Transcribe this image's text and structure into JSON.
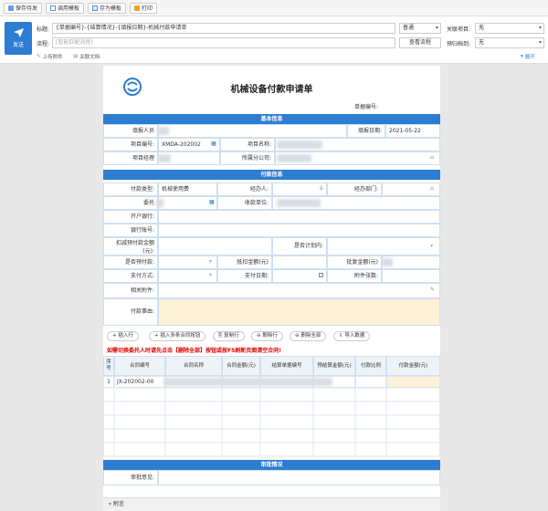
{
  "toolbar": {
    "buttons": [
      {
        "label": "保存待发",
        "icon": "save-icon"
      },
      {
        "label": "调用模板",
        "icon": "template-icon"
      },
      {
        "label": "存为模板",
        "icon": "save-as-template-icon"
      },
      {
        "label": "打印",
        "icon": "print-icon"
      }
    ]
  },
  "header": {
    "send_label": "发送",
    "title_label": "标题:",
    "title_value": "{单据编号}-{结算情况}-{填报日期}-机械付款申请单",
    "flow_label": "流程:",
    "flow_placeholder": "[智能匹配流程]",
    "level_value": "普通",
    "view_flow_label": "查看流程",
    "related_project_label": "关联项目:",
    "related_project_value": "无",
    "archive_label": "预归档到:",
    "archive_value": "无",
    "upload_label": "上传附件",
    "related_doc_label": "关联文档",
    "expand_label": "展开"
  },
  "form": {
    "title": "机械设备付款申请单",
    "doc_no_label": "单据编号:",
    "basic_section": "基本信息",
    "payment_section": "付款信息",
    "fields": {
      "reporter": "填报人员",
      "report_date": "填报日期:",
      "report_date_value": "2021-05-22",
      "project_no": "项目编号:",
      "project_no_value": "XMDA-202002",
      "project_name": "项目名称:",
      "project_manager": "项目经理",
      "branch": "所属分公司:",
      "pay_type": "付款类型:",
      "pay_type_value": "机械使用费",
      "handler": "经办人:",
      "handler_dept": "经办部门:",
      "entrust": "委托",
      "payee": "收款单位:",
      "bank": "开户银行:",
      "account": "银行账号:",
      "plan_amount": "扣减预付款金额",
      "plan_amount_unit": "(元):",
      "in_plan": "是否计划内:",
      "prepay": "是否预付款:",
      "deduct": "抵扣金额(元)",
      "approved": "批复金额(元)",
      "pay_method": "支付方式:",
      "pay_date": "支付日期:",
      "attach_count": "附件张数:",
      "attachments": "相关附件:",
      "reason": "付款事由:"
    },
    "actions": [
      "插入行",
      "插入多条合同按钮",
      "复制行",
      "删除行",
      "删除全部",
      "导入数据"
    ],
    "warning": "如需切换委托人时请先点击【删除全部】按钮或按F5刷新页面清空合同!",
    "table_headers": [
      "序号",
      "合同编号",
      "合同名称",
      "合同金额(元)",
      "结算单据编号",
      "预结算金额(元)",
      "付款比例",
      "付款金额(元)"
    ],
    "rows": [
      {
        "no": "1",
        "contract_no": "JX-202002-00"
      }
    ],
    "approval_section": "审批情况",
    "approval_opinion": "审批意见:"
  },
  "footer": {
    "attachments": "附言"
  }
}
